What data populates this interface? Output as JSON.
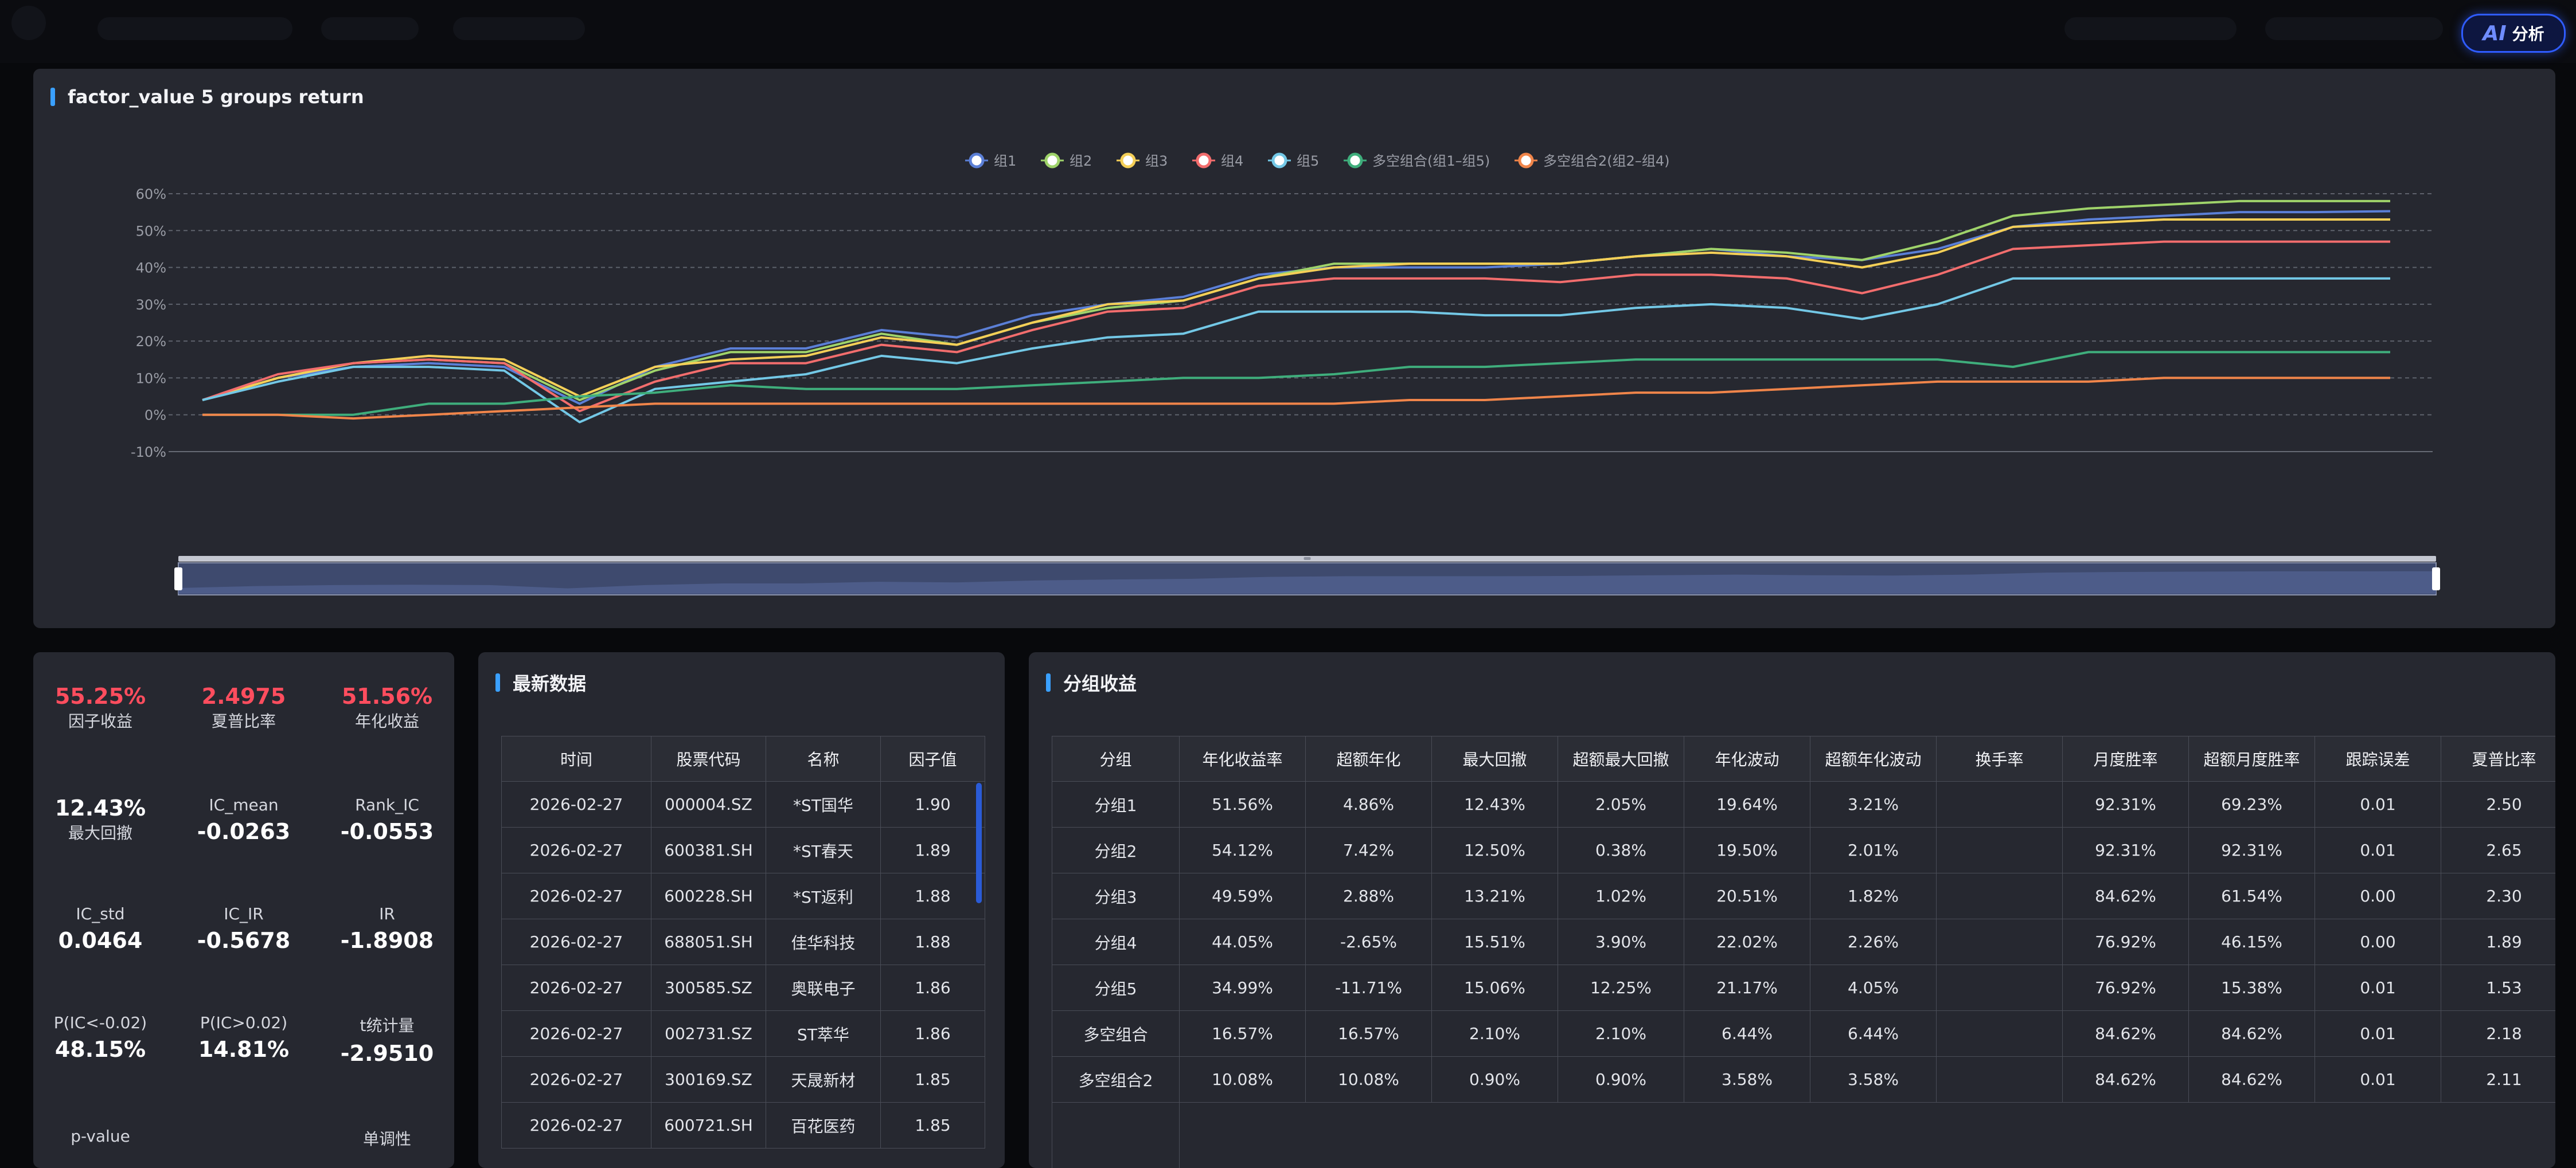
{
  "header": {
    "ai_label": "AI",
    "ai_text": "分析"
  },
  "chart_panel": {
    "title": "factor_value 5 groups return"
  },
  "chart_data": {
    "type": "line",
    "title": "factor_value 5 groups return",
    "ylim": [
      -10,
      60
    ],
    "yticks": [
      "60%",
      "50%",
      "40%",
      "30%",
      "20%",
      "10%",
      "0%",
      "-10%"
    ],
    "grid": true,
    "legend_position": "top-center",
    "x_count": 30,
    "series": [
      {
        "name": "组1",
        "color": "#5b7fd6",
        "values": [
          4,
          10,
          13,
          14,
          13,
          3,
          13,
          18,
          18,
          23,
          21,
          27,
          30,
          32,
          38,
          40,
          40,
          40,
          41,
          43,
          45,
          43,
          42,
          45,
          51,
          53,
          54,
          55,
          55,
          55.25
        ]
      },
      {
        "name": "组2",
        "color": "#9fd36a",
        "values": [
          4,
          10,
          14,
          15,
          14,
          4,
          12,
          17,
          17,
          22,
          19,
          25,
          29,
          31,
          37,
          41,
          41,
          41,
          41,
          43,
          45,
          44,
          42,
          47,
          54,
          56,
          57,
          58,
          58,
          58
        ]
      },
      {
        "name": "组3",
        "color": "#f4cf57",
        "values": [
          4,
          10,
          14,
          16,
          15,
          5,
          13,
          15,
          16,
          21,
          19,
          25,
          30,
          31,
          37,
          40,
          41,
          41,
          41,
          43,
          44,
          43,
          40,
          44,
          51,
          52,
          53,
          53,
          53,
          53
        ]
      },
      {
        "name": "组4",
        "color": "#f26d6d",
        "values": [
          4,
          11,
          14,
          15,
          14,
          1,
          9,
          14,
          14,
          19,
          17,
          23,
          28,
          29,
          35,
          37,
          37,
          37,
          36,
          38,
          38,
          37,
          33,
          38,
          45,
          46,
          47,
          47,
          47,
          47
        ]
      },
      {
        "name": "组5",
        "color": "#73c8e6",
        "values": [
          4,
          9,
          13,
          13,
          12,
          -2,
          7,
          9,
          11,
          16,
          14,
          18,
          21,
          22,
          28,
          28,
          28,
          27,
          27,
          29,
          30,
          29,
          26,
          30,
          37,
          37,
          37,
          37,
          37,
          37
        ]
      },
      {
        "name": "多空组合(组1–组5)",
        "color": "#3fae7c",
        "values": [
          0,
          0,
          0,
          3,
          3,
          5,
          6,
          8,
          7,
          7,
          7,
          8,
          9,
          10,
          10,
          11,
          13,
          13,
          14,
          15,
          15,
          15,
          15,
          15,
          13,
          17,
          17,
          17,
          17,
          17
        ]
      },
      {
        "name": "多空组合2(组2–组4)",
        "color": "#f0854a",
        "values": [
          0,
          0,
          -1,
          0,
          1,
          2,
          3,
          3,
          3,
          3,
          3,
          3,
          3,
          3,
          3,
          3,
          4,
          4,
          5,
          6,
          6,
          7,
          8,
          9,
          9,
          9,
          10,
          10,
          10,
          10
        ]
      }
    ]
  },
  "factor_stats": [
    {
      "value": "55.25%",
      "label": "因子收益",
      "red": true
    },
    {
      "value": "2.4975",
      "label": "夏普比率",
      "red": true
    },
    {
      "value": "51.56%",
      "label": "年化收益",
      "red": true
    },
    {
      "value": "12.43%",
      "label": "最大回撤"
    },
    {
      "label": "IC_mean",
      "value": "-0.0263"
    },
    {
      "label": "Rank_IC",
      "value": "-0.0553"
    },
    {
      "label": "IC_std",
      "value": "0.0464"
    },
    {
      "label": "IC_IR",
      "value": "-0.5678"
    },
    {
      "label": "IR",
      "value": "-1.8908"
    },
    {
      "label": "P(IC<-0.02)",
      "value": "48.15%"
    },
    {
      "label": "P(IC>0.02)",
      "value": "14.81%"
    },
    {
      "label": "t统计量",
      "value": "-2.9510"
    },
    {
      "label": "p-value",
      "value": ""
    },
    {
      "label": "单调性",
      "value": ""
    }
  ],
  "latest": {
    "title": "最新数据",
    "headers": [
      "时间",
      "股票代码",
      "名称",
      "因子值"
    ],
    "rows": [
      [
        "2026-02-27",
        "000004.SZ",
        "*ST国华",
        "1.90"
      ],
      [
        "2026-02-27",
        "600381.SH",
        "*ST春天",
        "1.89"
      ],
      [
        "2026-02-27",
        "600228.SH",
        "*ST返利",
        "1.88"
      ],
      [
        "2026-02-27",
        "688051.SH",
        "佳华科技",
        "1.88"
      ],
      [
        "2026-02-27",
        "300585.SZ",
        "奥联电子",
        "1.86"
      ],
      [
        "2026-02-27",
        "002731.SZ",
        "ST萃华",
        "1.86"
      ],
      [
        "2026-02-27",
        "300169.SZ",
        "天晟新材",
        "1.85"
      ],
      [
        "2026-02-27",
        "600721.SH",
        "百花医药",
        "1.85"
      ]
    ]
  },
  "groups": {
    "title": "分组收益",
    "headers": [
      "分组",
      "年化收益率",
      "超额年化",
      "最大回撤",
      "超额最大回撤",
      "年化波动",
      "超额年化波动",
      "换手率",
      "月度胜率",
      "超额月度胜率",
      "跟踪误差",
      "夏普比率"
    ],
    "rows": [
      [
        "分组1",
        "51.56%",
        "4.86%",
        "12.43%",
        "2.05%",
        "19.64%",
        "3.21%",
        "",
        "92.31%",
        "69.23%",
        "0.01",
        "2.50"
      ],
      [
        "分组2",
        "54.12%",
        "7.42%",
        "12.50%",
        "0.38%",
        "19.50%",
        "2.01%",
        "",
        "92.31%",
        "92.31%",
        "0.01",
        "2.65"
      ],
      [
        "分组3",
        "49.59%",
        "2.88%",
        "13.21%",
        "1.02%",
        "20.51%",
        "1.82%",
        "",
        "84.62%",
        "61.54%",
        "0.00",
        "2.30"
      ],
      [
        "分组4",
        "44.05%",
        "-2.65%",
        "15.51%",
        "3.90%",
        "22.02%",
        "2.26%",
        "",
        "76.92%",
        "46.15%",
        "0.00",
        "1.89"
      ],
      [
        "分组5",
        "34.99%",
        "-11.71%",
        "15.06%",
        "12.25%",
        "21.17%",
        "4.05%",
        "",
        "76.92%",
        "15.38%",
        "0.01",
        "1.53"
      ],
      [
        "多空组合",
        "16.57%",
        "16.57%",
        "2.10%",
        "2.10%",
        "6.44%",
        "6.44%",
        "",
        "84.62%",
        "84.62%",
        "0.01",
        "2.18"
      ],
      [
        "多空组合2",
        "10.08%",
        "10.08%",
        "0.90%",
        "0.90%",
        "3.58%",
        "3.58%",
        "",
        "84.62%",
        "84.62%",
        "0.01",
        "2.11"
      ]
    ]
  }
}
